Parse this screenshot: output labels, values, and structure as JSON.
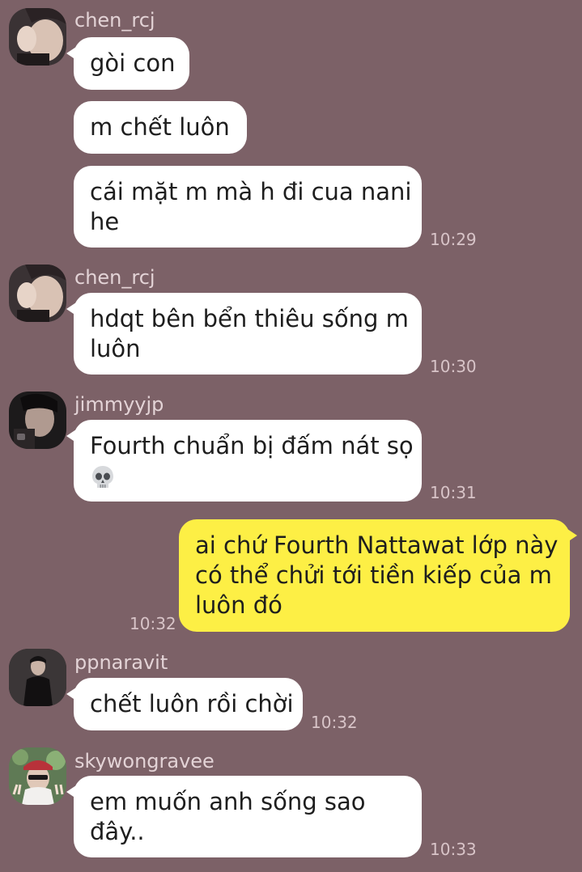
{
  "users": {
    "chen": "chen_rcj",
    "jimmy": "jimmyyjp",
    "pp": "ppnaravit",
    "sky": "skywongravee"
  },
  "messages": {
    "m1": "gòi con",
    "m2": "m chết luôn",
    "m3_l1": "cái mặt m mà h đi cua nani",
    "m3_l2": "he",
    "m4_l1": "hdqt bên bển thiêu sống m",
    "m4_l2": "luôn",
    "m5_l1": "Fourth chuẩn bị đấm nát sọ",
    "m5_emoji": "skull-emoji",
    "m6_l1": "ai chứ Fourth Nattawat lớp này",
    "m6_l2": "có thể chửi tới tiền kiếp của m",
    "m6_l3": "luôn đó",
    "m7": "chết luôn rồi chời",
    "m8_l1": "em muốn anh sống sao",
    "m8_l2": "đây.."
  },
  "times": {
    "t1": "10:29",
    "t2": "10:30",
    "t3": "10:31",
    "t4": "10:32",
    "t5": "10:32",
    "t6": "10:33"
  },
  "colors": {
    "background": "#7c6167",
    "bubble_in": "#ffffff",
    "bubble_out": "#fdef45"
  }
}
